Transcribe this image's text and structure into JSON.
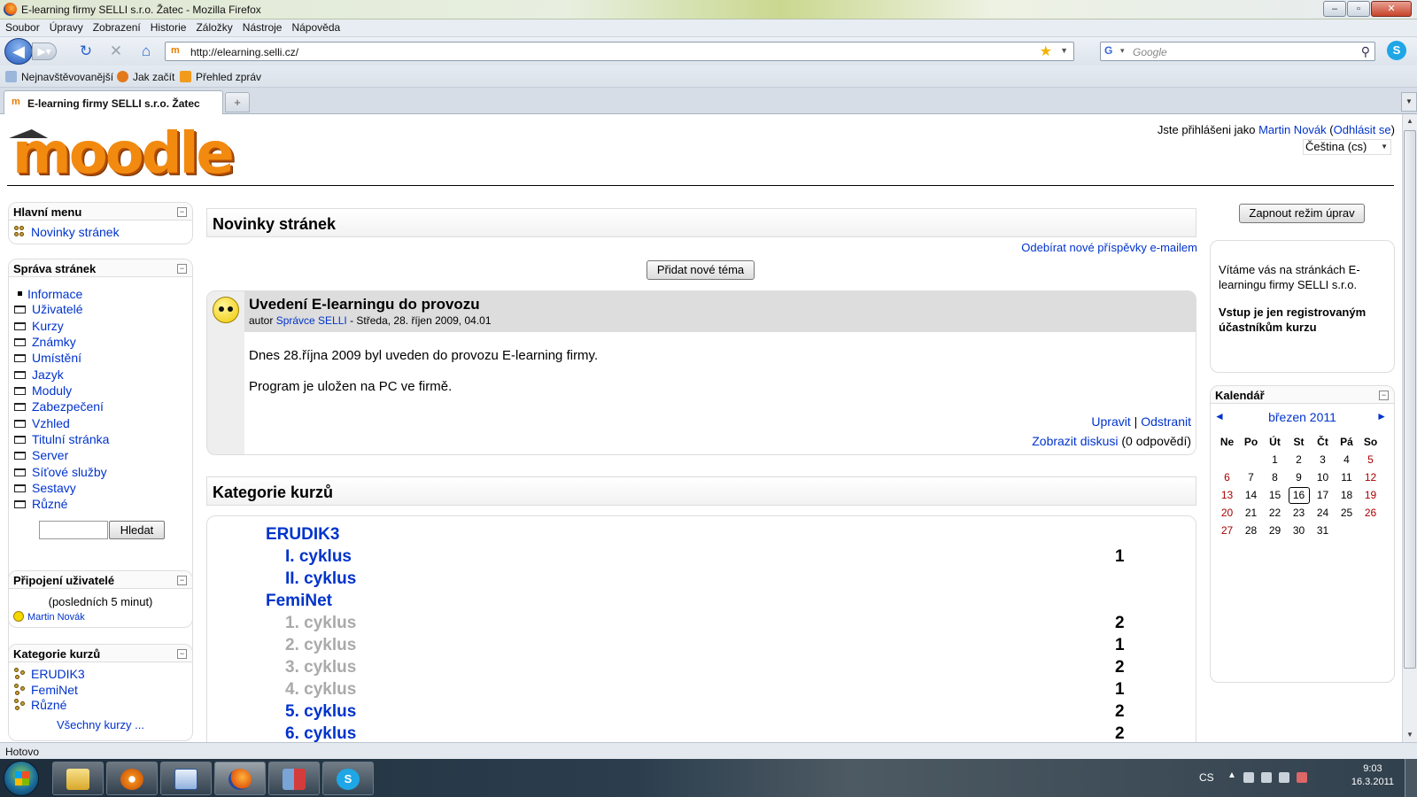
{
  "window": {
    "title": "E-learning firmy SELLI s.r.o. Žatec - Mozilla Firefox"
  },
  "menu": [
    "Soubor",
    "Úpravy",
    "Zobrazení",
    "Historie",
    "Záložky",
    "Nástroje",
    "Nápověda"
  ],
  "nav": {
    "url": "http://elearning.selli.cz/",
    "search_placeholder": "Google"
  },
  "bookmarks": [
    "Nejnavštěvovanější",
    "Jak začít",
    "Přehled zpráv"
  ],
  "tab": {
    "title": "E-learning firmy SELLI s.r.o. Žatec",
    "new_tab": "+"
  },
  "header": {
    "logo_text": "moodle",
    "logged_in_prefix": "Jste přihlášeni jako ",
    "user": "Martin Novák",
    "logout": "Odhlásit se",
    "language": "Čeština (cs)"
  },
  "left": {
    "main_menu": {
      "title": "Hlavní menu",
      "items": [
        "Novinky stránek"
      ]
    },
    "admin": {
      "title": "Správa stránek",
      "items": [
        "Informace",
        "Uživatelé",
        "Kurzy",
        "Známky",
        "Umístění",
        "Jazyk",
        "Moduly",
        "Zabezpečení",
        "Vzhled",
        "Titulní stránka",
        "Server",
        "Síťové služby",
        "Sestavy",
        "Různé"
      ],
      "search_button": "Hledat"
    },
    "online": {
      "title": "Připojení uživatelé",
      "period": "(posledních 5 minut)",
      "users": [
        "Martin Novák"
      ]
    },
    "categories": {
      "title": "Kategorie kurzů",
      "items": [
        "ERUDIK3",
        "FemiNet",
        "Různé"
      ],
      "all": "Všechny kurzy ..."
    }
  },
  "center": {
    "news_title": "Novinky stránek",
    "subscribe": "Odebírat nové příspěvky e-mailem",
    "add_topic": "Přidat nové téma",
    "post": {
      "subject": "Uvedení E-learningu do provozu",
      "author_prefix": "autor ",
      "author": "Správce SELLI",
      "date": " - Středa, 28. říjen 2009, 04.01",
      "p1": "Dnes 28.října 2009 byl uveden do provozu E-learning firmy.",
      "p2": "Program je uložen na PC ve firmě.",
      "edit": "Upravit",
      "sep": " | ",
      "delete": "Odstranit",
      "discussion": "Zobrazit diskusi",
      "replies": " (0 odpovědí)"
    },
    "categories_title": "Kategorie kurzů",
    "categories": [
      {
        "name": "ERUDIK3",
        "level": 0,
        "count": ""
      },
      {
        "name": "I. cyklus",
        "level": 1,
        "count": "1"
      },
      {
        "name": "II. cyklus",
        "level": 1,
        "count": ""
      },
      {
        "name": "FemiNet",
        "level": 0,
        "count": ""
      },
      {
        "name": "1. cyklus",
        "level": 1,
        "count": "2",
        "dim": true
      },
      {
        "name": "2. cyklus",
        "level": 1,
        "count": "1",
        "dim": true
      },
      {
        "name": "3. cyklus",
        "level": 1,
        "count": "2",
        "dim": true
      },
      {
        "name": "4. cyklus",
        "level": 1,
        "count": "1",
        "dim": true
      },
      {
        "name": "5. cyklus",
        "level": 1,
        "count": "2"
      },
      {
        "name": "6. cyklus",
        "level": 1,
        "count": "2"
      }
    ]
  },
  "right": {
    "edit_button": "Zapnout režim úprav",
    "welcome_1": "Vítáme vás na stránkách E-learningu firmy SELLI s.r.o.",
    "welcome_2": "Vstup je jen registrovaným účastníkům kurzu",
    "calendar": {
      "title": "Kalendář",
      "month": "březen 2011",
      "prev": "◄",
      "next": "►",
      "days": [
        "Ne",
        "Po",
        "Út",
        "St",
        "Čt",
        "Pá",
        "So"
      ],
      "weeks": [
        [
          "",
          "",
          "1",
          "2",
          "3",
          "4",
          "5"
        ],
        [
          "6",
          "7",
          "8",
          "9",
          "10",
          "11",
          "12"
        ],
        [
          "13",
          "14",
          "15",
          "16",
          "17",
          "18",
          "19"
        ],
        [
          "20",
          "21",
          "22",
          "23",
          "24",
          "25",
          "26"
        ],
        [
          "27",
          "28",
          "29",
          "30",
          "31",
          "",
          ""
        ]
      ],
      "today": "16"
    }
  },
  "status": "Hotovo",
  "taskbar": {
    "lang": "CS",
    "time": "9:03",
    "date": "16.3.2011"
  },
  "colors": {
    "link": "#0033cc",
    "weekend": "#aa0000",
    "dim": "#aaaaaa"
  }
}
